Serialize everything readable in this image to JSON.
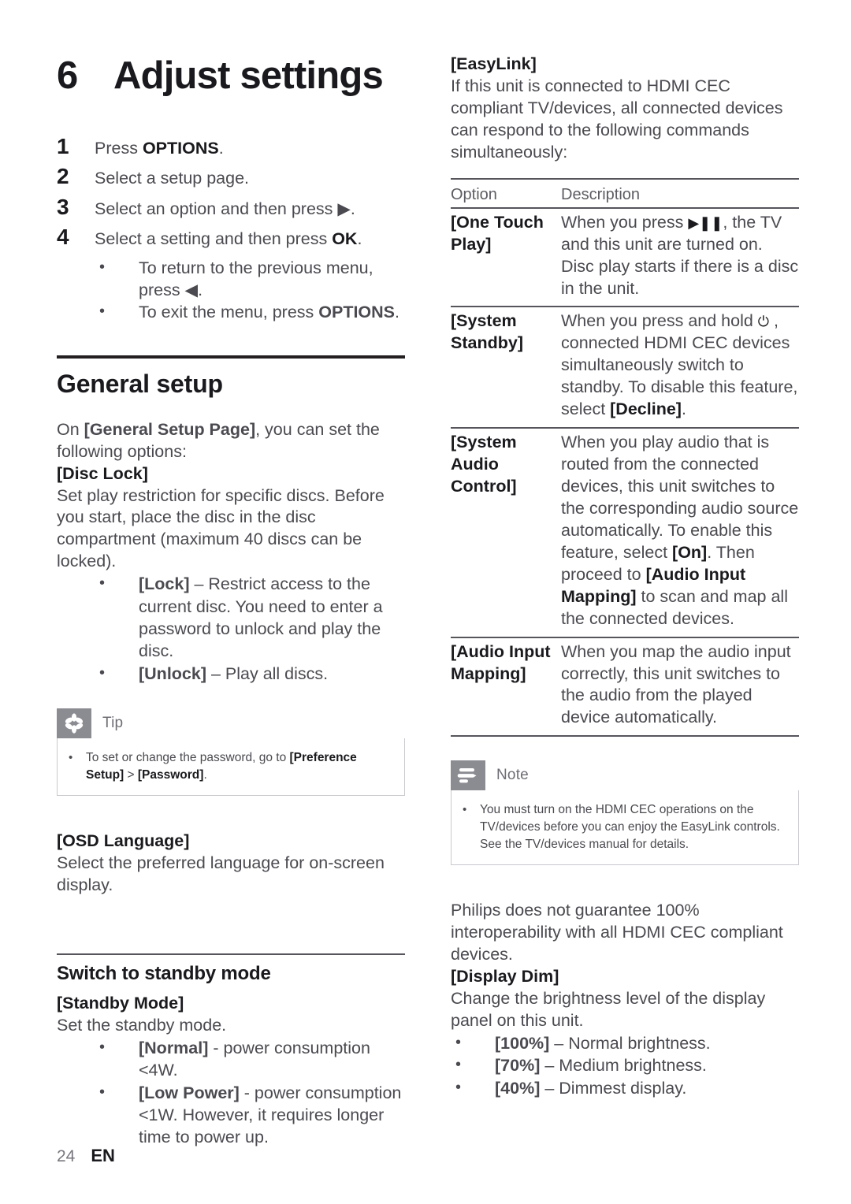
{
  "chapter": {
    "number": "6",
    "title": "Adjust settings"
  },
  "steps": [
    {
      "num": "1",
      "text_html": "Press <b>OPTIONS</b>."
    },
    {
      "num": "2",
      "text_html": "Select a setup page."
    },
    {
      "num": "3",
      "text_html": "Select an option and then press ▶."
    },
    {
      "num": "4",
      "text_html": "Select a setting and then press <b>OK</b>."
    }
  ],
  "step_subbullets": [
    {
      "bullet": "•",
      "text_html": "To return to the previous menu, press ◀."
    },
    {
      "bullet": "•",
      "text_html": "To exit the menu, press <b>OPTIONS</b>."
    }
  ],
  "general_setup": {
    "heading": "General setup",
    "intro_html": "On <b>[General Setup Page]</b>, you can set the following options:",
    "disc_lock": {
      "term": "[Disc Lock]",
      "body": "Set play restriction for specific discs. Before you start, place the disc in the disc compartment (maximum 40 discs can be locked).",
      "bullets": [
        {
          "bullet": "•",
          "text_html": "<b>[Lock]</b> – Restrict access to the current disc. You need to enter a password to unlock and play the disc."
        },
        {
          "bullet": "•",
          "text_html": "<b>[Unlock]</b> – Play all discs."
        }
      ]
    },
    "osd_language": {
      "term": "[OSD Language]",
      "body": "Select the preferred language for on-screen display."
    }
  },
  "tip_box": {
    "label": "Tip",
    "icon": "asterisk-flower-icon",
    "items": [
      {
        "bullet": "•",
        "text_html": "To set or change the password, go to <b>[Preference Setup]</b> > <b>[Password]</b>."
      }
    ]
  },
  "standby_section": {
    "heading": "Switch to standby mode",
    "term": "[Standby Mode]",
    "body": "Set the standby mode.",
    "bullets": [
      {
        "bullet": "•",
        "text_html": "<b>[Normal]</b> - power consumption <4W."
      },
      {
        "bullet": "•",
        "text_html": "<b>[Low Power]</b> - power consumption <1W. However, it requires longer time to power up."
      }
    ]
  },
  "easylink": {
    "term": "[EasyLink]",
    "body": "If this unit is connected to HDMI CEC compliant TV/devices, all connected devices can respond to the following commands simultaneously:",
    "table": {
      "headers": [
        "Option",
        "Description"
      ],
      "rows": [
        {
          "option": "[One Touch Play]",
          "description_html": "When you press <span class=\"glyph\">▶❚❚</span>, the TV and this unit are turned on. Disc play starts if there is a disc in the unit."
        },
        {
          "option": "[System Standby]",
          "description_html": "When you press and hold <span class=\"glyph\">⏻</span> , connected HDMI CEC devices simultaneously switch to standby. To disable this feature, select <b>[Decline]</b>."
        },
        {
          "option": "[System Audio Control]",
          "description_html": "When you play audio that is routed from the connected devices, this unit switches to the corresponding audio source automatically. To enable this feature, select <b>[On]</b>. Then proceed to <b>[Audio Input Mapping]</b> to scan and map all the connected devices."
        },
        {
          "option": "[Audio Input Mapping]",
          "description_html": "When you map the audio input correctly, this unit switches to the audio from the played device automatically."
        }
      ]
    }
  },
  "note_box": {
    "label": "Note",
    "icon": "lines-note-icon",
    "items": [
      {
        "bullet": "•",
        "text_html": "You must turn on the HDMI CEC operations on the TV/devices before you can enjoy the EasyLink controls. See the TV/devices manual for details."
      }
    ]
  },
  "philips_note": "Philips does not guarantee 100% interoperability with all HDMI CEC compliant devices.",
  "display_dim": {
    "term": "[Display Dim]",
    "body": "Change the brightness level of the display panel on this unit.",
    "bullets": [
      {
        "bullet": "•",
        "text_html": "<b>[100%]</b> – Normal brightness."
      },
      {
        "bullet": "•",
        "text_html": "<b>[70%]</b> – Medium brightness."
      },
      {
        "bullet": "•",
        "text_html": "<b>[40%]</b> – Dimmest display."
      }
    ]
  },
  "footer": {
    "page_number": "24",
    "language": "EN"
  },
  "colors": {
    "text": "#4a4a50",
    "heading": "#1a1a1e",
    "rule": "#231f20",
    "badge": "#8b8b92",
    "box_border": "#c9c9cf"
  }
}
